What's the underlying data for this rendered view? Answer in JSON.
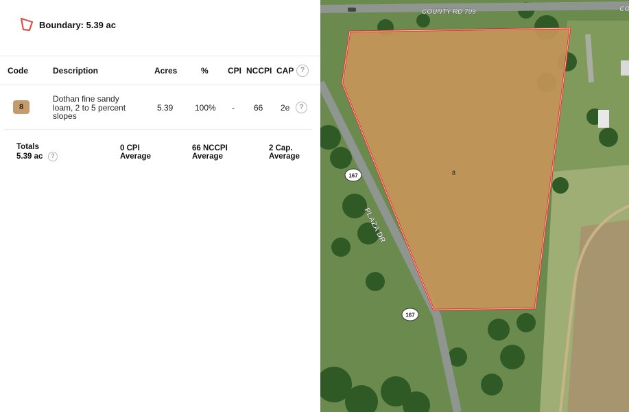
{
  "boundary": {
    "label": "Boundary: 5.39 ac"
  },
  "table": {
    "headers": {
      "code": "Code",
      "description": "Description",
      "acres": "Acres",
      "pct": "%",
      "cpi": "CPI",
      "nccpi": "NCCPI",
      "cap": "CAP"
    },
    "rows": [
      {
        "code": "8",
        "description": "Dothan fine sandy loam, 2 to 5 percent slopes",
        "acres": "5.39",
        "pct": "100%",
        "cpi": "-",
        "nccpi": "66",
        "cap": "2e"
      }
    ]
  },
  "totals": {
    "label": "Totals",
    "acres": "5.39 ac",
    "cpi_value": "0 CPI",
    "cpi_sub": "Average",
    "nccpi_value": "66 NCCPI",
    "nccpi_sub": "Average",
    "cap_value": "2 Cap.",
    "cap_sub": "Average"
  },
  "help_glyph": "?",
  "map": {
    "road_top": "COUNTY RD 709",
    "road_corner": "CO",
    "road_side": "PLAZA DR",
    "shield_label": "167",
    "polygon_label": "8",
    "colors": {
      "boundary": "#e2231a",
      "fill": "#c8955a",
      "road": "#9aa09a"
    }
  }
}
